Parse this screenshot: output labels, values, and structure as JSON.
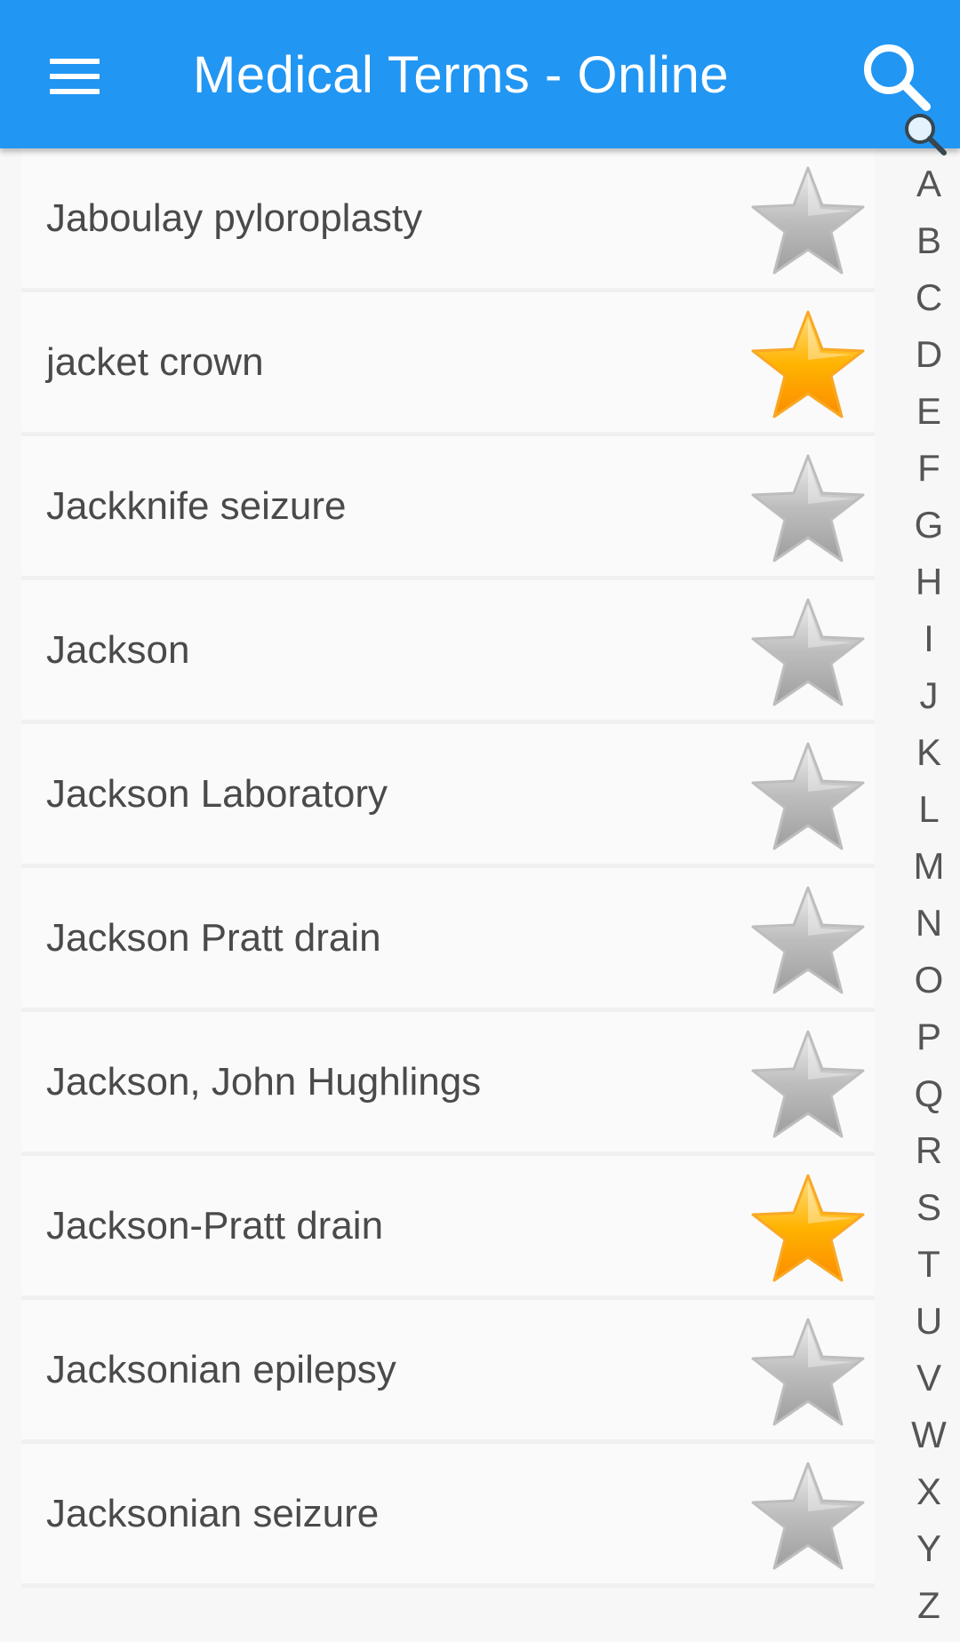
{
  "appbar": {
    "title": "Medical Terms - Online",
    "color": "#2196f3",
    "menu_icon": "hamburger-menu-icon",
    "search_icon": "search-icon"
  },
  "terms": [
    {
      "label": "Jaboulay pyloroplasty",
      "favorite": false
    },
    {
      "label": "jacket crown",
      "favorite": true
    },
    {
      "label": "Jackknife seizure",
      "favorite": false
    },
    {
      "label": "Jackson",
      "favorite": false
    },
    {
      "label": "Jackson Laboratory",
      "favorite": false
    },
    {
      "label": "Jackson Pratt drain",
      "favorite": false
    },
    {
      "label": "Jackson, John Hughlings",
      "favorite": false
    },
    {
      "label": "Jackson-Pratt drain",
      "favorite": true
    },
    {
      "label": "Jacksonian epilepsy",
      "favorite": false
    },
    {
      "label": "Jacksonian seizure",
      "favorite": false
    }
  ],
  "alphabet_index": [
    "A",
    "B",
    "C",
    "D",
    "E",
    "F",
    "G",
    "H",
    "I",
    "J",
    "K",
    "L",
    "M",
    "N",
    "O",
    "P",
    "Q",
    "R",
    "S",
    "T",
    "U",
    "V",
    "W",
    "X",
    "Y",
    "Z"
  ],
  "colors": {
    "favorite_star": "#ffa726",
    "normal_star": "#b0b0b0",
    "text": "#4a4a4a"
  }
}
